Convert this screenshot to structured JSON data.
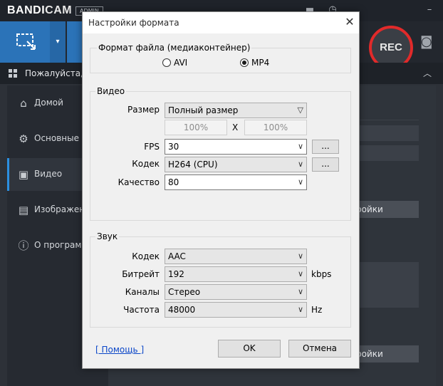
{
  "app": {
    "brand_part1": "BANDI",
    "brand_part2": "CAM",
    "badge": "ADMIN",
    "rec_label": "REC",
    "subbar_text": "Пожалуйста, в",
    "bg_button_1": "ройки",
    "bg_button_2": "ройки",
    "accent_color": "#2b73b8",
    "rec_color": "#e12a2a"
  },
  "sidebar": {
    "items": [
      {
        "label": "Домой",
        "icon": "home-icon"
      },
      {
        "label": "Основные",
        "icon": "gear-icon"
      },
      {
        "label": "Видео",
        "icon": "video-icon"
      },
      {
        "label": "Изображени",
        "icon": "image-icon"
      },
      {
        "label": "О программ",
        "icon": "info-icon"
      }
    ],
    "active_index": 2
  },
  "dialog": {
    "title": "Настройки формата",
    "container_group": {
      "label": "Формат файла (медиаконтейнер)",
      "options": [
        "AVI",
        "MP4"
      ],
      "selected": "MP4"
    },
    "video": {
      "label": "Видео",
      "size_label": "Размер",
      "size_value": "Полный размер",
      "width_pct": "100%",
      "x_sep": "X",
      "height_pct": "100%",
      "fps_label": "FPS",
      "fps_value": "30",
      "codec_label": "Кодек",
      "codec_value": "H264 (CPU)",
      "quality_label": "Качество",
      "quality_value": "80",
      "more_button": "..."
    },
    "audio": {
      "label": "Звук",
      "codec_label": "Кодек",
      "codec_value": "AAC",
      "bitrate_label": "Битрейт",
      "bitrate_value": "192",
      "bitrate_unit": "kbps",
      "channels_label": "Каналы",
      "channels_value": "Стерео",
      "freq_label": "Частота",
      "freq_value": "48000",
      "freq_unit": "Hz"
    },
    "help_link": "[ Помощь ]",
    "ok_button": "OK",
    "cancel_button": "Отмена"
  }
}
